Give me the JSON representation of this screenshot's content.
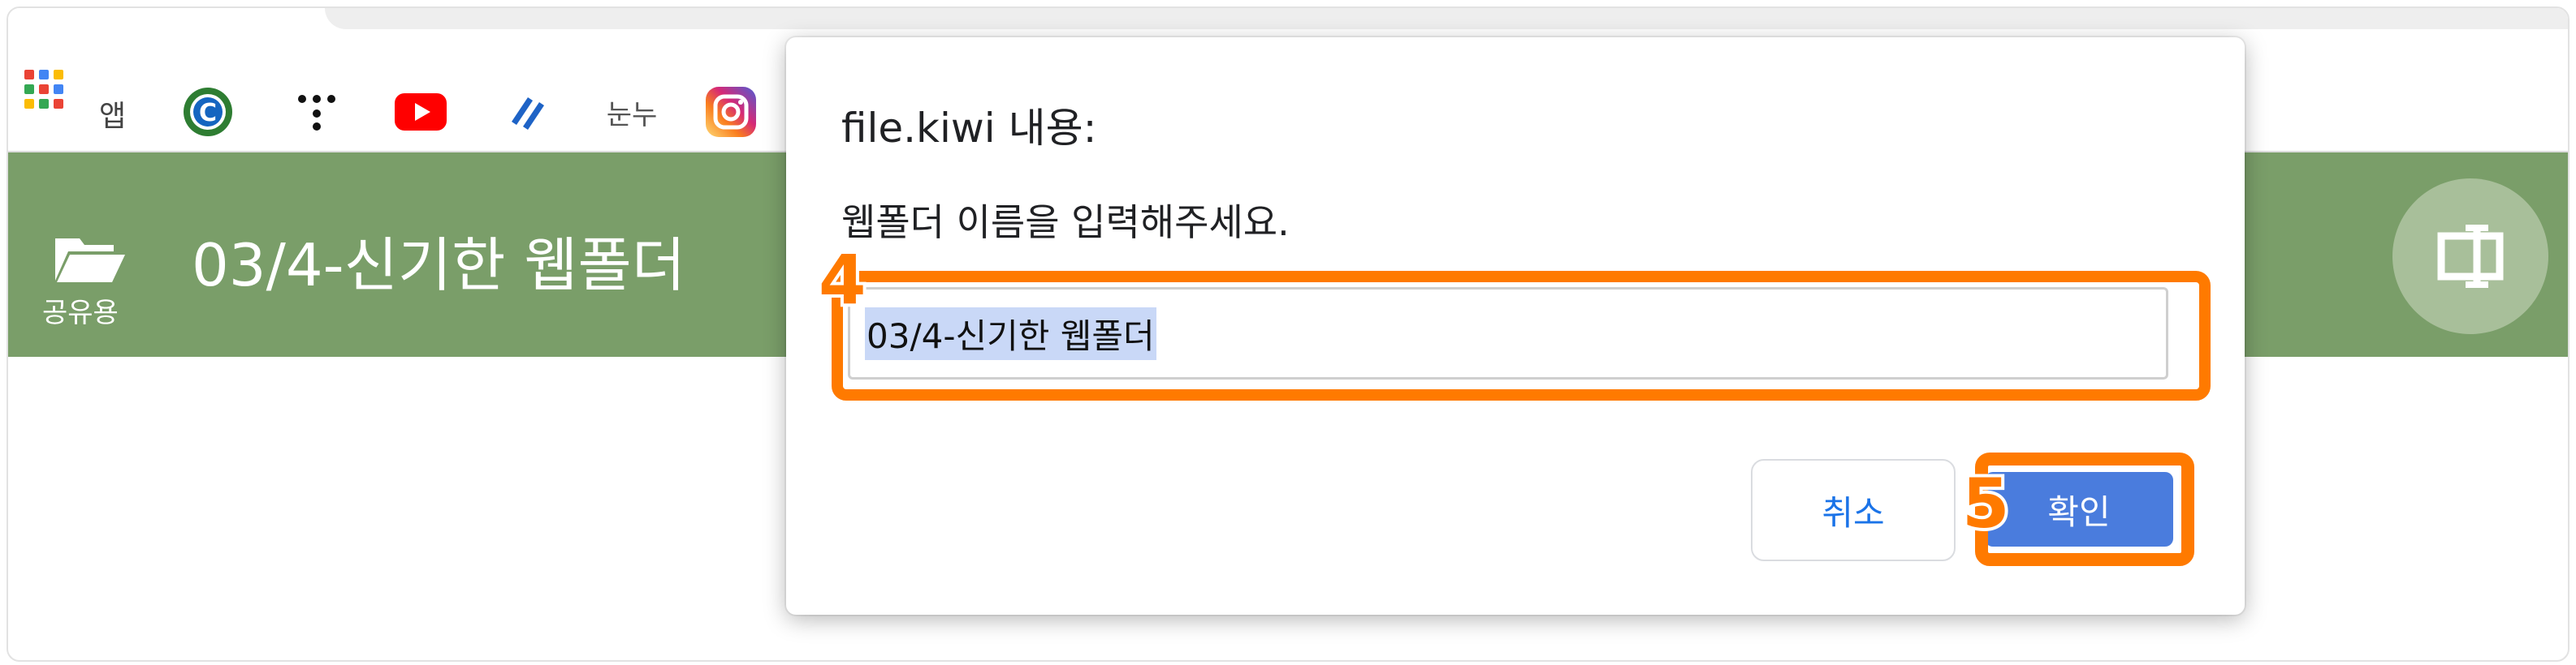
{
  "bookmarks": {
    "apps_label": "앱",
    "items": [
      {
        "icon": "c-circle-icon"
      },
      {
        "icon": "dots-icon"
      },
      {
        "icon": "youtube-icon"
      },
      {
        "icon": "flag-icon"
      },
      {
        "icon": "nunu-logo",
        "text": "눈누"
      },
      {
        "icon": "instagram-icon"
      }
    ]
  },
  "appbar": {
    "folder_caption": "공유용",
    "folder_title": "03/4-신기한 웹폴더",
    "background": "#7a9e69"
  },
  "dialog": {
    "title": "file.kiwi 내용:",
    "message": "웹폴더 이름을 입력해주세요.",
    "input_value": "03/4-신기한 웹폴더",
    "cancel_label": "취소",
    "ok_label": "확인"
  },
  "annotations": {
    "step_input": "4",
    "step_ok": "5",
    "highlight_color": "#ff7a00"
  }
}
